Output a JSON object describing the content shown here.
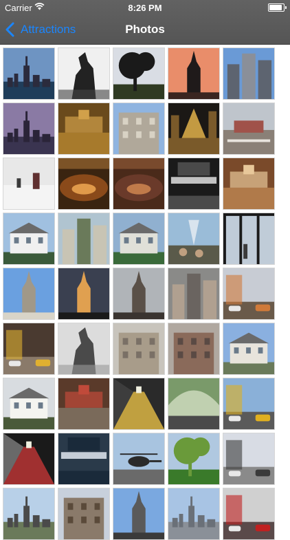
{
  "status_bar": {
    "carrier": "Carrier",
    "time": "8:26 PM",
    "battery_level": 0.9,
    "wifi_icon": "wifi-icon",
    "battery_icon": "battery-icon"
  },
  "nav": {
    "back_label": "Attractions",
    "back_icon": "chevron-left-icon",
    "title": "Photos",
    "accent": "#1a86ff"
  },
  "photos": [
    {
      "id": "empire-skyline",
      "sky": "#6e94c2",
      "ground": "#1f3d5a",
      "tint": "#2b2b3d",
      "kind": "skyline"
    },
    {
      "id": "liberty",
      "sky": "#f0f0f0",
      "ground": "#444444",
      "tint": "#222222",
      "kind": "statue"
    },
    {
      "id": "park-tree",
      "sky": "#d9dde4",
      "ground": "#2f3a22",
      "tint": "#1a1a1a",
      "kind": "tree"
    },
    {
      "id": "chrysler-sunset",
      "sky": "#e98d6a",
      "ground": "#3a2520",
      "tint": "#1f1a1a",
      "kind": "tower"
    },
    {
      "id": "midtown-towers",
      "sky": "#6a9ad6",
      "ground": "#8a8f99",
      "tint": "#5d6470",
      "kind": "towers"
    },
    {
      "id": "empire-dusk",
      "sky": "#8a7aa4",
      "ground": "#3a3450",
      "tint": "#2a2438",
      "kind": "skyline"
    },
    {
      "id": "un-hall",
      "sky": "#6a4a1c",
      "ground": "#a77a2c",
      "tint": "#d1a04a",
      "kind": "hall"
    },
    {
      "id": "un-building",
      "sky": "#8fb4e0",
      "ground": "#d8d2c4",
      "tint": "#b0a89a",
      "kind": "building"
    },
    {
      "id": "rockefeller-night",
      "sky": "#1b1815",
      "ground": "#7a5a2a",
      "tint": "#e0b24a",
      "kind": "lights"
    },
    {
      "id": "rockefeller-plaza",
      "sky": "#bfc5cc",
      "ground": "#8a8077",
      "tint": "#a0524a",
      "kind": "plaza"
    },
    {
      "id": "snow-park",
      "sky": "#e8e8e8",
      "ground": "#f4f4f4",
      "tint": "#603030",
      "kind": "snow"
    },
    {
      "id": "arena-lights",
      "sky": "#3a2410",
      "ground": "#8a4a1a",
      "tint": "#e09a4a",
      "kind": "arena"
    },
    {
      "id": "garden-court",
      "sky": "#4a2a1a",
      "ground": "#6a3a2a",
      "tint": "#c07a4a",
      "kind": "arena"
    },
    {
      "id": "msg-sign",
      "sky": "#1a1a1a",
      "ground": "#4a4a4a",
      "tint": "#e0e0e0",
      "kind": "sign"
    },
    {
      "id": "grand-central",
      "sky": "#7a4a2a",
      "ground": "#b07a4a",
      "tint": "#e8c89a",
      "kind": "hall"
    },
    {
      "id": "white-house-porch",
      "sky": "#a0c0e0",
      "ground": "#3a5a3a",
      "tint": "#f0f0f0",
      "kind": "house"
    },
    {
      "id": "park-towers",
      "sky": "#b0c4d0",
      "ground": "#6a7a5a",
      "tint": "#c8c4b4",
      "kind": "towers"
    },
    {
      "id": "garden-mansion",
      "sky": "#90b0d0",
      "ground": "#3a6a3a",
      "tint": "#e0e0d8",
      "kind": "house"
    },
    {
      "id": "fountain",
      "sky": "#9abcd8",
      "ground": "#5a5a4a",
      "tint": "#c0a080",
      "kind": "fountain"
    },
    {
      "id": "window-view",
      "sky": "#c0ccd8",
      "ground": "#3a3a3a",
      "tint": "#1a1a1a",
      "kind": "window"
    },
    {
      "id": "gothic-tower",
      "sky": "#6aa0e0",
      "ground": "#d8d4c8",
      "tint": "#a09888",
      "kind": "tower"
    },
    {
      "id": "tower-dusk",
      "sky": "#3a4050",
      "ground": "#1a1a1a",
      "tint": "#e0a050",
      "kind": "tower"
    },
    {
      "id": "church-spire",
      "sky": "#b0b4b8",
      "ground": "#3a3430",
      "tint": "#5a5048",
      "kind": "tower"
    },
    {
      "id": "aerial-city",
      "sky": "#8a8a88",
      "ground": "#6a6460",
      "tint": "#b0a090",
      "kind": "towers"
    },
    {
      "id": "autumn-street",
      "sky": "#c8ccd4",
      "ground": "#6a5a4a",
      "tint": "#d07a3a",
      "kind": "street"
    },
    {
      "id": "taxi-street",
      "sky": "#4a3a30",
      "ground": "#8a7a6a",
      "tint": "#e0b030",
      "kind": "street"
    },
    {
      "id": "monument",
      "sky": "#dcdcdc",
      "ground": "#9a9a9a",
      "tint": "#4a4a4a",
      "kind": "statue"
    },
    {
      "id": "library-facade",
      "sky": "#c8c4bc",
      "ground": "#7a7066",
      "tint": "#a89c8a",
      "kind": "building"
    },
    {
      "id": "brick-building",
      "sky": "#b0a8a0",
      "ground": "#5a4a44",
      "tint": "#8a6a5a",
      "kind": "building"
    },
    {
      "id": "colonial-house",
      "sky": "#8ab0e0",
      "ground": "#6a7a5a",
      "tint": "#e8e4dc",
      "kind": "house"
    },
    {
      "id": "white-house",
      "sky": "#d8dce0",
      "ground": "#4a5a3a",
      "tint": "#f4f4f0",
      "kind": "house"
    },
    {
      "id": "market-hall",
      "sky": "#5a3a2a",
      "ground": "#7a6a5a",
      "tint": "#c04a3a",
      "kind": "hall"
    },
    {
      "id": "train-platform",
      "sky": "#2a2a2a",
      "ground": "#c0a040",
      "tint": "#5a5a5a",
      "kind": "platform"
    },
    {
      "id": "terminal-arch",
      "sky": "#7a9a6a",
      "ground": "#4a4a4a",
      "tint": "#c0d0b0",
      "kind": "arch"
    },
    {
      "id": "yellow-cab",
      "sky": "#8ab0d8",
      "ground": "#5a5a5a",
      "tint": "#e0b020",
      "kind": "street"
    },
    {
      "id": "subway-tunnel",
      "sky": "#1a1a1a",
      "ground": "#a03030",
      "tint": "#e0e0e0",
      "kind": "platform"
    },
    {
      "id": "nbc-studio",
      "sky": "#2a3a4a",
      "ground": "#1a2a3a",
      "tint": "#e0e8f0",
      "kind": "sign"
    },
    {
      "id": "helicopter",
      "sky": "#a8c4e0",
      "ground": "#6a6a6a",
      "tint": "#2a2a2a",
      "kind": "heli"
    },
    {
      "id": "garden-green",
      "sky": "#b0c8e0",
      "ground": "#3a7a2a",
      "tint": "#6a9a3a",
      "kind": "tree"
    },
    {
      "id": "harbor-crowd",
      "sky": "#d8dce4",
      "ground": "#8a8a8a",
      "tint": "#3a3a3a",
      "kind": "street"
    },
    {
      "id": "harbor-sky",
      "sky": "#b8d0e8",
      "ground": "#6a7a5a",
      "tint": "#4a4a4a",
      "kind": "skyline"
    },
    {
      "id": "rooftop",
      "sky": "#c8d0dc",
      "ground": "#5a4a3a",
      "tint": "#8a7a6a",
      "kind": "building"
    },
    {
      "id": "crane-tower",
      "sky": "#7aa8e0",
      "ground": "#3a3a3a",
      "tint": "#5a5a5a",
      "kind": "tower"
    },
    {
      "id": "skyline-blue",
      "sky": "#a8c4e4",
      "ground": "#8a9098",
      "tint": "#6a7078",
      "kind": "skyline"
    },
    {
      "id": "store-front",
      "sky": "#d0d0d0",
      "ground": "#5a4a4a",
      "tint": "#c02020",
      "kind": "street"
    }
  ]
}
